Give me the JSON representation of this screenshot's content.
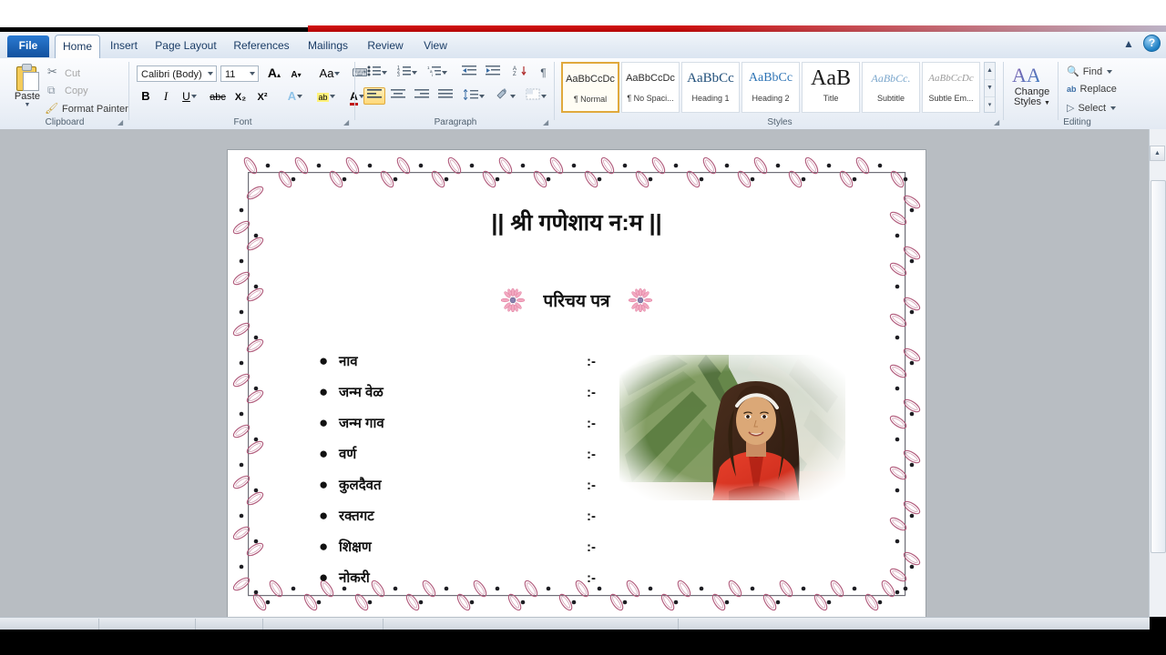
{
  "window": {
    "help_icon": "help-icon",
    "collapse_icon": "chevron-up-icon"
  },
  "tabs": [
    {
      "label": "File",
      "active": false,
      "file": true
    },
    {
      "label": "Home",
      "active": true
    },
    {
      "label": "Insert",
      "active": false
    },
    {
      "label": "Page Layout",
      "active": false
    },
    {
      "label": "References",
      "active": false
    },
    {
      "label": "Mailings",
      "active": false
    },
    {
      "label": "Review",
      "active": false
    },
    {
      "label": "View",
      "active": false
    }
  ],
  "ribbon": {
    "clipboard": {
      "name": "Clipboard",
      "paste": "Paste",
      "cut": "Cut",
      "copy": "Copy",
      "format_painter": "Format Painter"
    },
    "font": {
      "name": "Font",
      "font_family": "Calibri (Body)",
      "font_size": "11",
      "grow_font": "A",
      "shrink_font": "A",
      "change_case": "Aa",
      "clear_formatting": "clear-formatting-icon",
      "bold": "B",
      "italic": "I",
      "underline": "U",
      "strikethrough": "abc",
      "subscript": "X₂",
      "superscript": "X²",
      "text_effects": "A",
      "highlight": "ab",
      "font_color": "A"
    },
    "paragraph": {
      "name": "Paragraph",
      "bullets": "bullets-icon",
      "numbering": "numbering-icon",
      "multilevel": "multilevel-list-icon",
      "decrease_indent": "decrease-indent-icon",
      "increase_indent": "increase-indent-icon",
      "sort": "sort-icon",
      "show_marks": "¶",
      "align_left": "align-left-icon",
      "align_center": "align-center-icon",
      "align_right": "align-right-icon",
      "justify": "justify-icon",
      "line_spacing": "line-spacing-icon",
      "shading": "shading-icon",
      "borders": "borders-icon"
    },
    "styles": {
      "name": "Styles",
      "items": [
        {
          "preview": "AaBbCcDc",
          "label": "¶ Normal",
          "selected": true,
          "style": "normal"
        },
        {
          "preview": "AaBbCcDc",
          "label": "¶ No Spaci...",
          "selected": false,
          "style": "normal"
        },
        {
          "preview": "AaBbCс",
          "label": "Heading 1",
          "selected": false,
          "style": "h1"
        },
        {
          "preview": "AaBbCc",
          "label": "Heading 2",
          "selected": false,
          "style": "h2"
        },
        {
          "preview": "AaB",
          "label": "Title",
          "selected": false,
          "style": "title"
        },
        {
          "preview": "AaBbCc.",
          "label": "Subtitle",
          "selected": false,
          "style": "subtitle"
        },
        {
          "preview": "AaBbCcDс",
          "label": "Subtle Em...",
          "selected": false,
          "style": "subtle"
        }
      ],
      "change_styles": "Change\nStyles"
    },
    "editing": {
      "name": "Editing",
      "find": "Find",
      "replace": "Replace",
      "select": "Select"
    }
  },
  "document": {
    "title": "|| श्री गणेशाय न:म ||",
    "subtitle": "परिचय पत्र",
    "flower_left": "flower-icon",
    "flower_right": "flower-icon",
    "colon_marker": ":-",
    "bullet_char": "●",
    "fields": [
      "नाव",
      "जन्म वेळ",
      "जन्म गाव",
      "वर्ण",
      "कुलदैवत",
      "रक्तगट",
      "शिक्षण",
      "नोकरी"
    ],
    "photo_alt": "photo-of-girl-in-red-top"
  },
  "colors": {
    "accent_red": "#c80f0f",
    "border_pink": "#b8577f",
    "border_leaf": "#c77ea0",
    "ribbon_blue": "#1d5fa8",
    "highlight_gold": "#e0a93c"
  }
}
